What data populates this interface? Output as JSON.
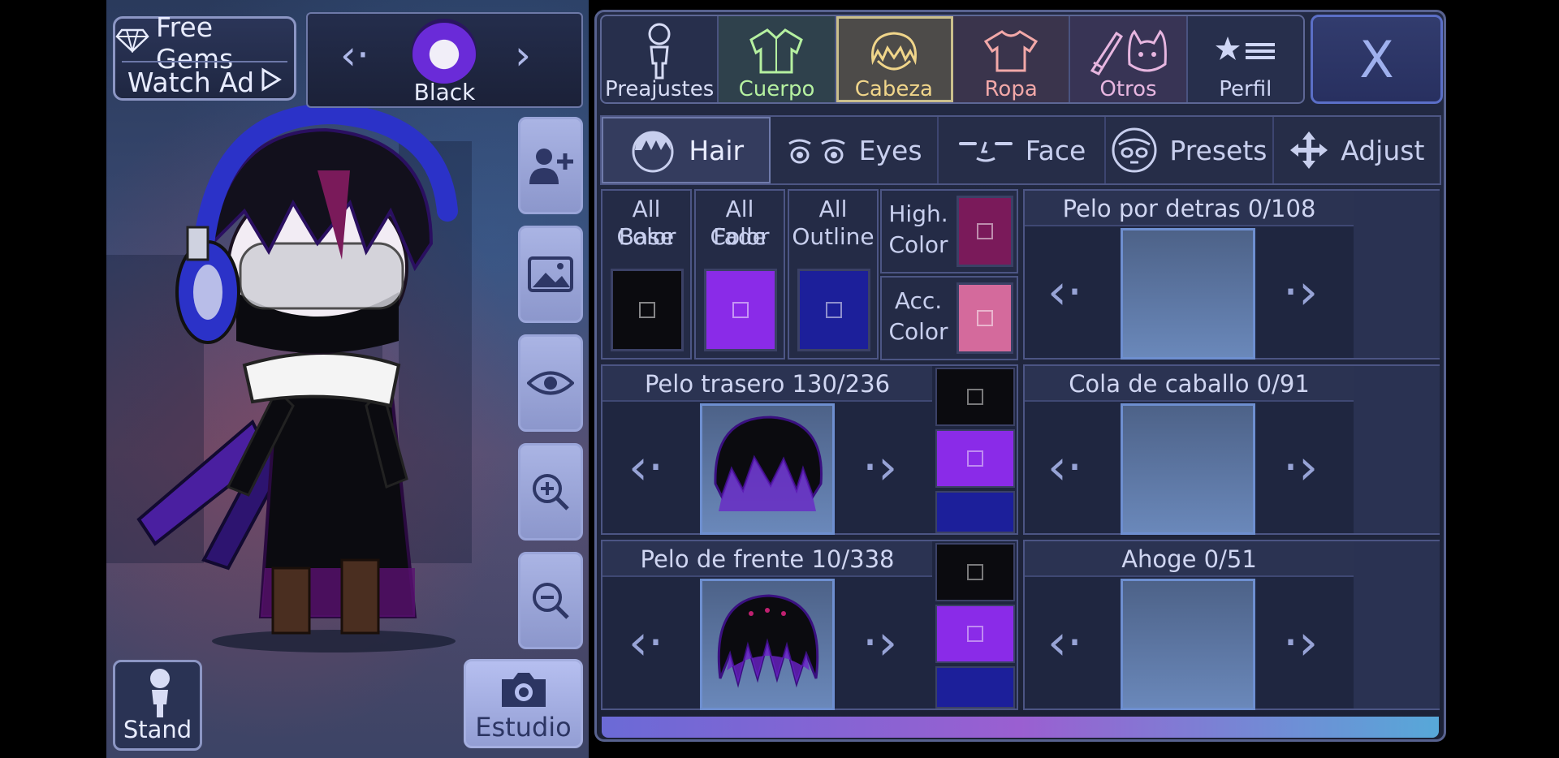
{
  "gems": {
    "free_gems": "Free Gems",
    "watch_ad": "Watch Ad"
  },
  "preset": {
    "name": "Black"
  },
  "stand": {
    "label": "Stand"
  },
  "estudio": {
    "label": "Estudio"
  },
  "categories": [
    {
      "label": "Preajustes",
      "color": "#d7dcf5",
      "icon": "body-silhouette-icon"
    },
    {
      "label": "Cuerpo",
      "color": "#b5f0a0",
      "icon": "jacket-icon"
    },
    {
      "label": "Cabeza",
      "color": "#f0d58a",
      "icon": "hair-icon",
      "active": true
    },
    {
      "label": "Ropa",
      "color": "#f2a8a8",
      "icon": "shirt-icon"
    },
    {
      "label": "Otros",
      "color": "#e7b6e0",
      "icon": "sword-cat-icon"
    },
    {
      "label": "Perfil",
      "color": "#cfd6f5",
      "icon": "star-list-icon"
    }
  ],
  "close": {
    "label": "X"
  },
  "subtabs": [
    {
      "label": "Hair",
      "icon": "hair-head-icon",
      "active": true
    },
    {
      "label": "Eyes",
      "icon": "eyes-icon"
    },
    {
      "label": "Face",
      "icon": "face-icon"
    },
    {
      "label": "Presets",
      "icon": "presets-face-icon"
    },
    {
      "label": "Adjust",
      "icon": "move-arrows-icon"
    }
  ],
  "color_cells": {
    "all_base": {
      "line1": "All Base",
      "line2": "Color",
      "color": "#0b0b0f"
    },
    "all_fade": {
      "line1": "All Fade",
      "line2": "Color",
      "color": "#8a2be8"
    },
    "all_outline": {
      "line1": "All",
      "line2": "Outline",
      "color": "#1c1f9a"
    },
    "high": {
      "line1": "High.",
      "line2": "Color",
      "color": "#7a1a5a"
    },
    "acc": {
      "line1": "Acc.",
      "line2": "Color",
      "color": "#d46a9c"
    }
  },
  "selectors": {
    "pelo_detras": {
      "title": "Pelo por detras 0/108"
    },
    "pelo_trasero": {
      "title": "Pelo trasero 130/236"
    },
    "cola_caballo": {
      "title": "Cola de caballo 0/91"
    },
    "pelo_frente": {
      "title": "Pelo de frente 10/338"
    },
    "ahoge": {
      "title": "Ahoge 0/51"
    }
  },
  "mini_swatch_colors": [
    "#0b0b0f",
    "#8a2be8",
    "#1c1f9a"
  ]
}
